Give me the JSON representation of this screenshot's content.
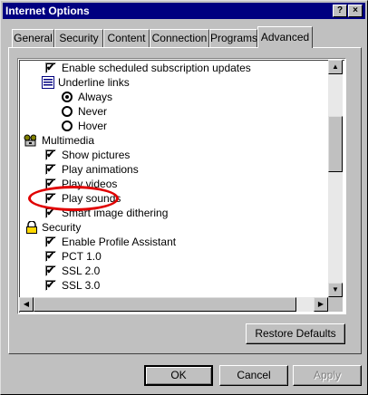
{
  "window": {
    "title": "Internet Options",
    "help_button": "?",
    "close_button": "×"
  },
  "tabs": [
    {
      "label": "General"
    },
    {
      "label": "Security"
    },
    {
      "label": "Content"
    },
    {
      "label": "Connection"
    },
    {
      "label": "Programs"
    },
    {
      "label": "Advanced",
      "active": true
    }
  ],
  "settings": {
    "items": [
      {
        "type": "checkbox",
        "label": "Enable scheduled subscription updates",
        "checked": true
      },
      {
        "type": "group",
        "icon": "underline-links-icon",
        "label": "Underline links"
      },
      {
        "type": "radio",
        "label": "Always",
        "selected": true
      },
      {
        "type": "radio",
        "label": "Never",
        "selected": false
      },
      {
        "type": "radio",
        "label": "Hover",
        "selected": false
      },
      {
        "type": "group",
        "icon": "multimedia-icon",
        "label": "Multimedia"
      },
      {
        "type": "checkbox",
        "label": "Show pictures",
        "checked": true
      },
      {
        "type": "checkbox",
        "label": "Play animations",
        "checked": true
      },
      {
        "type": "checkbox",
        "label": "Play videos",
        "checked": true
      },
      {
        "type": "checkbox",
        "label": "Play sounds",
        "checked": true
      },
      {
        "type": "checkbox",
        "label": "Smart image dithering",
        "checked": true
      },
      {
        "type": "group",
        "icon": "lock-icon",
        "label": "Security"
      },
      {
        "type": "checkbox",
        "label": "Enable Profile Assistant",
        "checked": true
      },
      {
        "type": "checkbox",
        "label": "PCT 1.0",
        "checked": true
      },
      {
        "type": "checkbox",
        "label": "SSL 2.0",
        "checked": true
      },
      {
        "type": "checkbox",
        "label": "SSL 3.0",
        "checked": true
      }
    ]
  },
  "restore_defaults_label": "Restore Defaults",
  "footer": {
    "ok_label": "OK",
    "cancel_label": "Cancel",
    "apply_label": "Apply"
  },
  "colors": {
    "titlebar": "#000080",
    "highlight_circle": "#e00000"
  }
}
